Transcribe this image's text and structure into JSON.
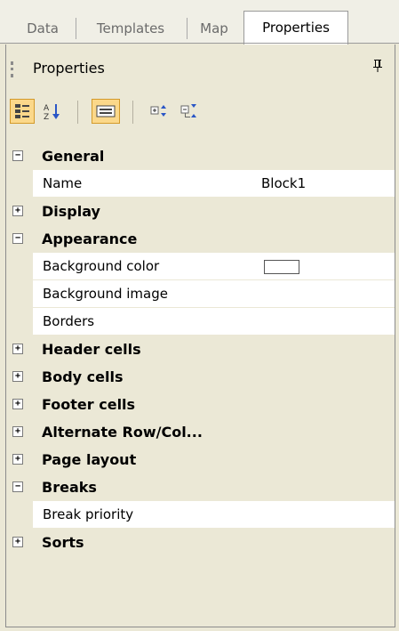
{
  "tabs": [
    {
      "label": "Data"
    },
    {
      "label": "Templates"
    },
    {
      "label": "Map"
    },
    {
      "label": "Properties"
    }
  ],
  "panel": {
    "title": "Properties",
    "pin_icon": "pin-icon"
  },
  "toolbar": {
    "buttons": [
      {
        "icon": "categorized-icon",
        "active": true
      },
      {
        "icon": "alphabetical-sort-icon",
        "active": false
      },
      {
        "icon": "property-pages-icon",
        "active": true
      },
      {
        "icon": "expand-all-icon",
        "active": false
      },
      {
        "icon": "collapse-all-icon",
        "active": false
      }
    ]
  },
  "grid": {
    "rows": [
      {
        "type": "category",
        "label": "General",
        "expanded": true
      },
      {
        "type": "property",
        "name": "Name",
        "value": "Block1"
      },
      {
        "type": "category",
        "label": "Display",
        "expanded": false
      },
      {
        "type": "category",
        "label": "Appearance",
        "expanded": true
      },
      {
        "type": "property",
        "name": "Background color",
        "value": "",
        "swatch": "#ffffff"
      },
      {
        "type": "property",
        "name": "Background image",
        "value": ""
      },
      {
        "type": "property",
        "name": "Borders",
        "value": ""
      },
      {
        "type": "category",
        "label": "Header cells",
        "expanded": false
      },
      {
        "type": "category",
        "label": "Body cells",
        "expanded": false
      },
      {
        "type": "category",
        "label": "Footer cells",
        "expanded": false
      },
      {
        "type": "category",
        "label": "Alternate Row/Col...",
        "expanded": false
      },
      {
        "type": "category",
        "label": "Page layout",
        "expanded": false
      },
      {
        "type": "category",
        "label": "Breaks",
        "expanded": true
      },
      {
        "type": "property",
        "name": "Break priority",
        "value": ""
      },
      {
        "type": "category",
        "label": "Sorts",
        "expanded": false
      }
    ]
  },
  "colors": {
    "background": "#ebe8d6",
    "toolbar_active": "#fbd88a"
  }
}
